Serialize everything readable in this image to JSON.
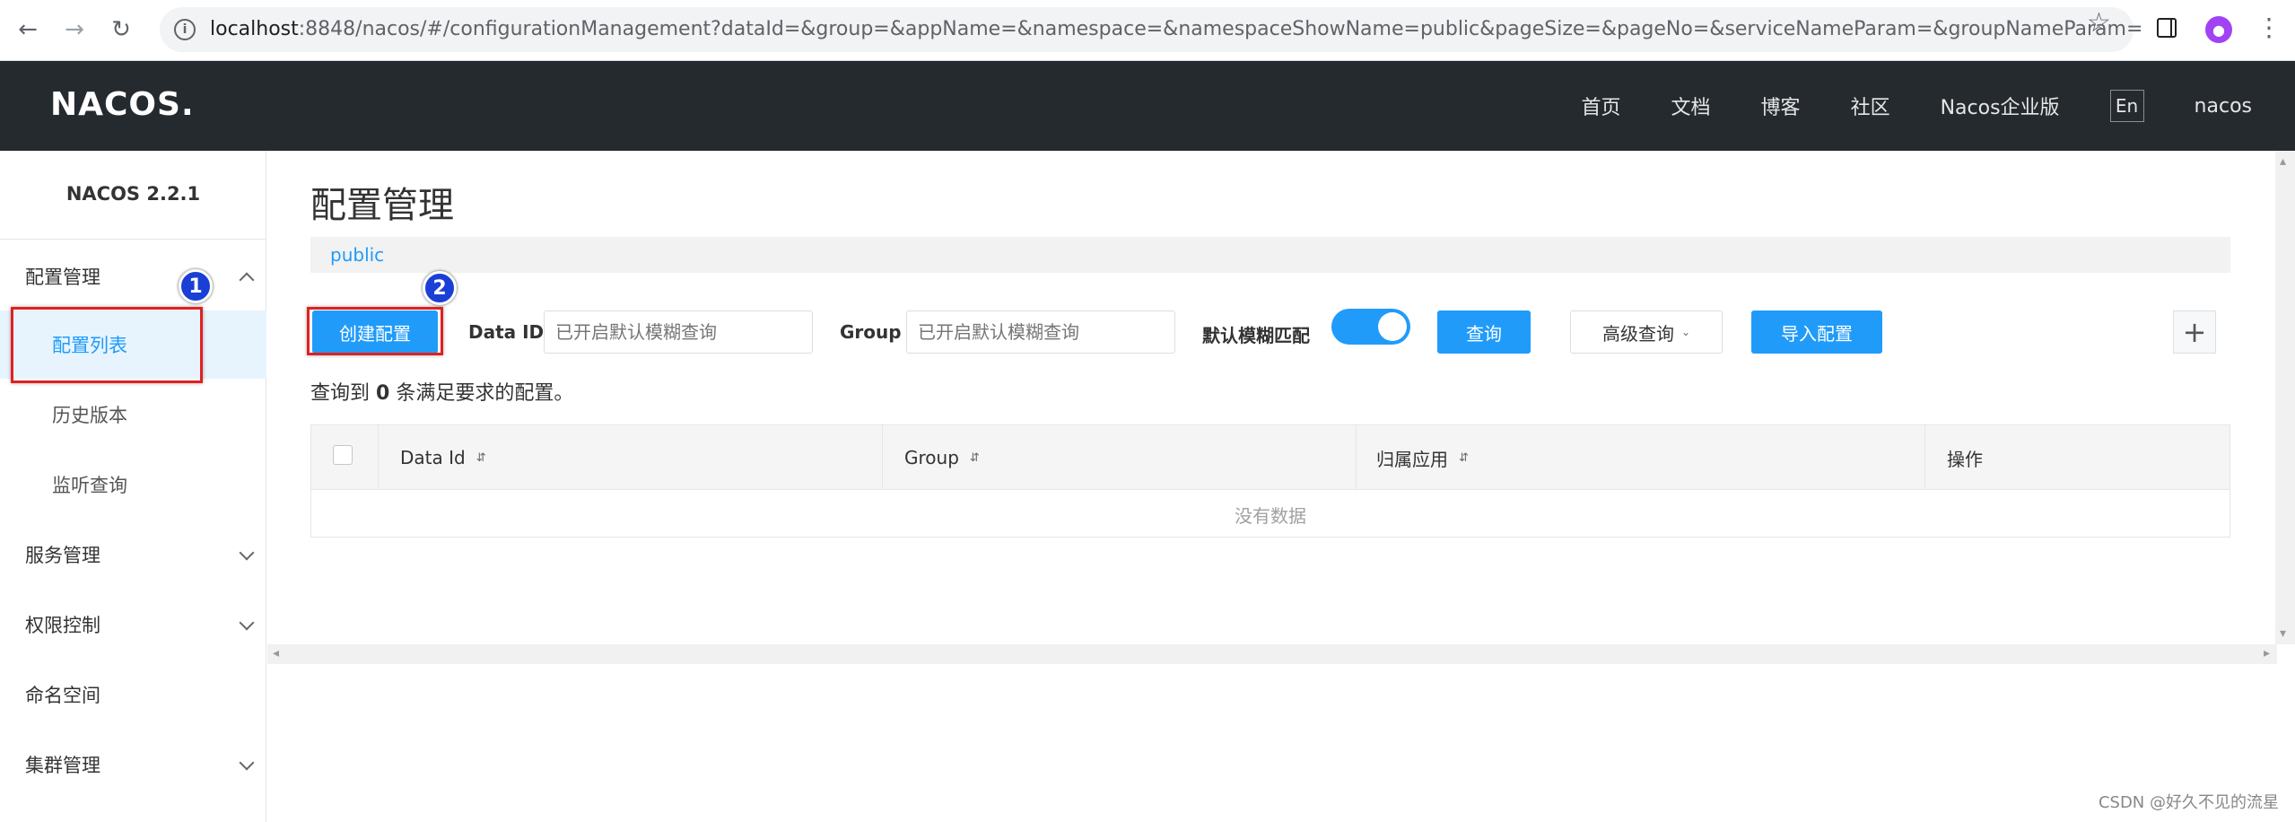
{
  "browser": {
    "url_host": "localhost",
    "url_rest": ":8848/nacos/#/configurationManagement?dataId=&group=&appName=&namespace=&namespaceShowName=public&pageSize=&pageNo=&serviceNameParam=&groupNameParam="
  },
  "header": {
    "logo": "NACOS.",
    "nav": [
      "首页",
      "文档",
      "博客",
      "社区",
      "Nacos企业版"
    ],
    "lang": "En",
    "user": "nacos"
  },
  "sidebar": {
    "version": "NACOS 2.2.1",
    "items": [
      {
        "label": "配置管理"
      },
      {
        "label": "配置列表"
      },
      {
        "label": "历史版本"
      },
      {
        "label": "监听查询"
      },
      {
        "label": "服务管理"
      },
      {
        "label": "权限控制"
      },
      {
        "label": "命名空间"
      },
      {
        "label": "集群管理"
      }
    ]
  },
  "annotations": {
    "badge1": "1",
    "badge2": "2"
  },
  "main": {
    "title": "配置管理",
    "namespace": "public",
    "create_button": "创建配置",
    "data_id_label": "Data ID",
    "data_id_placeholder": "已开启默认模糊查询",
    "group_label": "Group",
    "group_placeholder": "已开启默认模糊查询",
    "fuzzy_label": "默认模糊匹配",
    "fuzzy_enabled": true,
    "query_button": "查询",
    "advanced_button": "高级查询",
    "import_button": "导入配置",
    "result_prefix": "查询到",
    "result_count": "0",
    "result_suffix": "条满足要求的配置。",
    "table": {
      "columns": [
        "Data Id",
        "Group",
        "归属应用",
        "操作"
      ],
      "empty_text": "没有数据"
    }
  },
  "watermark": "CSDN @好久不见的流星",
  "colors": {
    "primary": "#209bfa",
    "header_bg": "#252a2f",
    "annotation_red": "#e02020",
    "badge_blue": "#1a3fd6"
  }
}
